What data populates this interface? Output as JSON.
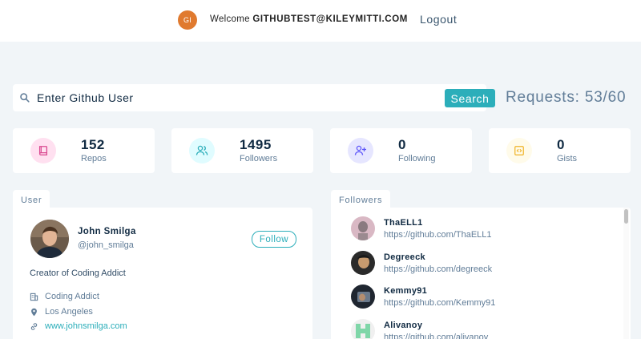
{
  "nav": {
    "avatar_initials": "GI",
    "welcome_text": "Welcome ",
    "user_email": "GITHUBTEST@KILEYMITTI.COM",
    "logout_label": "Logout"
  },
  "search": {
    "placeholder": "Enter Github User",
    "button_label": "Search",
    "requests_text": "Requests: 53/60"
  },
  "stats": [
    {
      "value": "152",
      "label": "Repos",
      "icon": "book-icon",
      "bg": "#ffe0f0",
      "color": "#da4a91"
    },
    {
      "value": "1495",
      "label": "Followers",
      "icon": "users-icon",
      "bg": "#e0fcff",
      "color": "#2caeba"
    },
    {
      "value": "0",
      "label": "Following",
      "icon": "user-plus-icon",
      "bg": "#e6e6ff",
      "color": "#5d55fa"
    },
    {
      "value": "0",
      "label": "Gists",
      "icon": "code-icon",
      "bg": "#fffbea",
      "color": "#f0b429"
    }
  ],
  "user": {
    "tab_label": "User",
    "name": "John Smilga",
    "handle": "@john_smilga",
    "follow_label": "Follow",
    "bio": "Creator of Coding Addict",
    "company": "Coding Addict",
    "location": "Los Angeles",
    "blog": "www.johnsmilga.com"
  },
  "followers": {
    "tab_label": "Followers",
    "items": [
      {
        "name": "ThaELL1",
        "url": "https://github.com/ThaELL1"
      },
      {
        "name": "Degreeck",
        "url": "https://github.com/degreeck"
      },
      {
        "name": "Kemmy91",
        "url": "https://github.com/Kemmy91"
      },
      {
        "name": "Alivanoy",
        "url": "https://github.com/alivanoy"
      }
    ]
  },
  "colors": {
    "accent": "#2caeba",
    "avatar_bg": "#e07a2f",
    "page_bg": "#f1f5f8"
  }
}
